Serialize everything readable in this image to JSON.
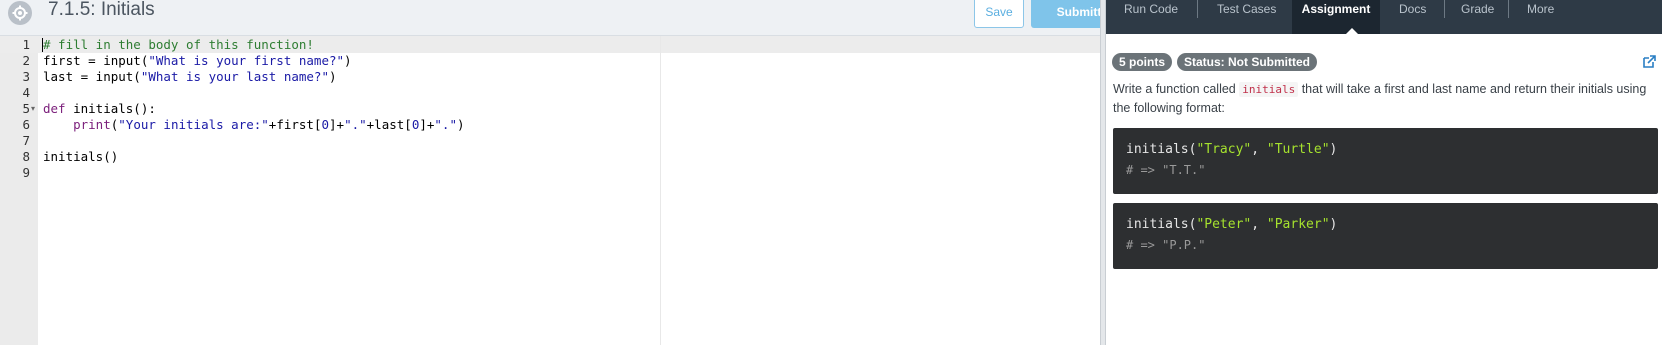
{
  "header": {
    "title": "7.1.5: Initials",
    "save_label": "Save",
    "submit_label": "Submitting..."
  },
  "editor": {
    "line_numbers": [
      "1",
      "2",
      "3",
      "4",
      "5",
      "6",
      "7",
      "8",
      "9"
    ],
    "lines": [
      [
        {
          "t": "# fill in the body of this function!",
          "c": "comment"
        }
      ],
      [
        {
          "t": "first = input(",
          "c": "plain"
        },
        {
          "t": "\"What is your first name?\"",
          "c": "str"
        },
        {
          "t": ")",
          "c": "plain"
        }
      ],
      [
        {
          "t": "last = input(",
          "c": "plain"
        },
        {
          "t": "\"What is your last name?\"",
          "c": "str"
        },
        {
          "t": ")",
          "c": "plain"
        }
      ],
      [],
      [
        {
          "t": "def",
          "c": "kw"
        },
        {
          "t": " initials():",
          "c": "plain"
        }
      ],
      [
        {
          "t": "    ",
          "c": "plain"
        },
        {
          "t": "print",
          "c": "kw"
        },
        {
          "t": "(",
          "c": "plain"
        },
        {
          "t": "\"Your initials are:\"",
          "c": "str"
        },
        {
          "t": "+first[",
          "c": "plain"
        },
        {
          "t": "0",
          "c": "num"
        },
        {
          "t": "]+",
          "c": "plain"
        },
        {
          "t": "\".\"",
          "c": "str"
        },
        {
          "t": "+last[",
          "c": "plain"
        },
        {
          "t": "0",
          "c": "num"
        },
        {
          "t": "]+",
          "c": "plain"
        },
        {
          "t": "\".\"",
          "c": "str"
        },
        {
          "t": ")",
          "c": "plain"
        }
      ],
      [],
      [
        {
          "t": "initials()",
          "c": "plain"
        }
      ],
      []
    ]
  },
  "tabs": [
    {
      "label": "Run Code"
    },
    {
      "label": "Test Cases"
    },
    {
      "label": "Assignment"
    },
    {
      "label": "Docs"
    },
    {
      "label": "Grade"
    },
    {
      "label": "More"
    }
  ],
  "assignment": {
    "points_badge": "5 points",
    "status_badge": "Status: Not Submitted",
    "desc_before": "Write a function called ",
    "desc_code": "initials",
    "desc_after": " that will take a first and last name and return their initials using the following format:",
    "examples": [
      {
        "fn": "initials(",
        "arg1": "\"Tracy\"",
        "sep": ", ",
        "arg2": "\"Turtle\"",
        "close": ")",
        "result": "# => \"T.T.\""
      },
      {
        "fn": "initials(",
        "arg1": "\"Peter\"",
        "sep": ", ",
        "arg2": "\"Parker\"",
        "close": ")",
        "result": "# => \"P.P.\""
      }
    ]
  },
  "colors": {
    "accent": "#7fc4ea",
    "tabbar": "#2e3a46",
    "active_tab": "#1c2630",
    "badge": "#6b7378",
    "codeblock": "#2d2f31"
  },
  "icons": [
    "gear-icon",
    "external-link-icon",
    "fold-arrow-icon"
  ]
}
